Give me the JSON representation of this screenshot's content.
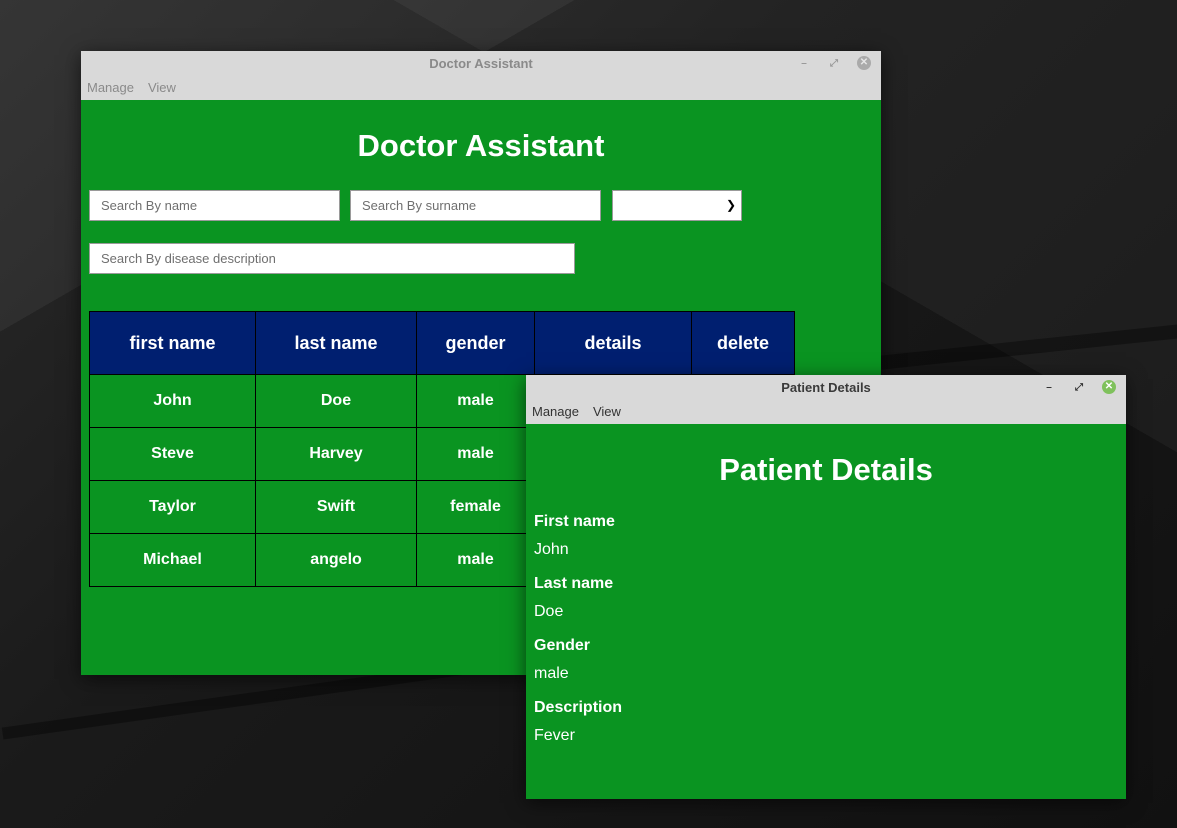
{
  "main_window": {
    "title": "Doctor Assistant",
    "menu": [
      "Manage",
      "View"
    ],
    "heading": "Doctor Assistant",
    "search_name_placeholder": "Search By name",
    "search_surname_placeholder": "Search By surname",
    "search_disease_placeholder": "Search By disease description",
    "gender_select_value": "",
    "table": {
      "headers": [
        "first name",
        "last name",
        "gender",
        "details",
        "delete"
      ],
      "rows": [
        [
          "John",
          "Doe",
          "male"
        ],
        [
          "Steve",
          "Harvey",
          "male"
        ],
        [
          "Taylor",
          "Swift",
          "female"
        ],
        [
          "Michael",
          "angelo",
          "male"
        ]
      ]
    },
    "controls": {
      "minimize_icon": "minimize-icon",
      "maximize_icon": "maximize-icon",
      "close_icon": "close-icon"
    }
  },
  "detail_window": {
    "title": "Patient Details",
    "menu": [
      "Manage",
      "View"
    ],
    "heading": "Patient Details",
    "fields": [
      {
        "label": "First name",
        "value": "John"
      },
      {
        "label": "Last name",
        "value": "Doe"
      },
      {
        "label": "Gender",
        "value": "male"
      },
      {
        "label": "Description",
        "value": "Fever"
      }
    ]
  },
  "colors": {
    "content_bg": "#0a9421",
    "table_header_bg": "#001f70",
    "titlebar_bg": "#d9d9d9",
    "detail_close": "#7fc15c"
  }
}
